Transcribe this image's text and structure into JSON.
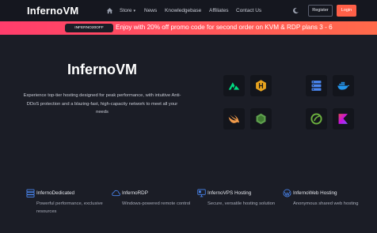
{
  "header": {
    "logo": "InfernoVM",
    "nav": {
      "store": "Store",
      "news": "News",
      "knowledgebase": "Knowledgebase",
      "affiliates": "Affiliates",
      "contact": "Contact Us"
    },
    "register_label": "Register",
    "login_label": "Login",
    "icons": [
      "home-icon",
      "moon-icon",
      "chevron-down-icon"
    ]
  },
  "promo": {
    "code": "INFERNO20OFF",
    "text": "Enjoy with 20% off promo code for second order on KVM & RDP plans 3 - 6"
  },
  "hero": {
    "title": "InfernoVM",
    "description": "Experience top-tier hosting designed for peak performance, with intuitive Anti-DDoS protection and a blazing-fast, high-capacity network to meet all your needs"
  },
  "tech_icons": [
    "nuxt-icon",
    "hono-icon",
    "server-icon",
    "docker-icon",
    "swift-icon",
    "nodejs-icon",
    "spring-icon",
    "kotlin-icon"
  ],
  "features": [
    {
      "title": "InfernoDedicated",
      "description": "Powerful performance, exclusive resources",
      "icon": "server-stack-icon"
    },
    {
      "title": "InfernoRDP",
      "description": "Windows-powered remote control",
      "icon": "cloud-icon"
    },
    {
      "title": "InfernoVPS Hosting",
      "description": "Secure, versatile hosting solution",
      "icon": "vps-icon"
    },
    {
      "title": "InfernoWeb Hosting",
      "description": "Anonymous shared web hosting",
      "icon": "wordpress-icon"
    }
  ],
  "colors": {
    "background": "#1b1d26",
    "header": "#15171f",
    "accent": "#ff6048",
    "promo_start": "#ff3d6c",
    "promo_end": "#ff6a4a",
    "feature_icon": "#4a86f0"
  }
}
